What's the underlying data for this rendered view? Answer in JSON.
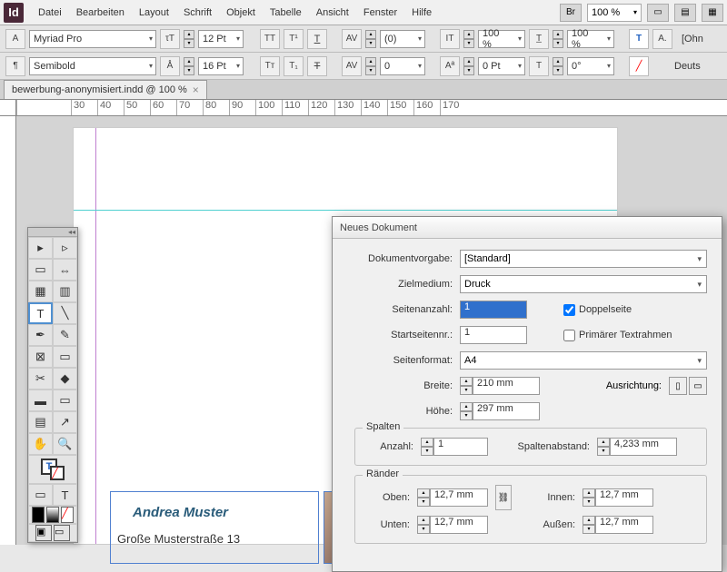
{
  "app": {
    "icon": "Id"
  },
  "menu": {
    "items": [
      "Datei",
      "Bearbeiten",
      "Layout",
      "Schrift",
      "Objekt",
      "Tabelle",
      "Ansicht",
      "Fenster",
      "Hilfe"
    ],
    "br_label": "Br",
    "zoom": "100 %"
  },
  "control": {
    "font": "Myriad Pro",
    "weight": "Semibold",
    "size": "12 Pt",
    "leading": "16 Pt",
    "tracking": "(0)",
    "baseline": "0",
    "vscale": "100 %",
    "hscale": "100 %",
    "xoffset": "0 Pt",
    "rotation": "0°",
    "lang": "Deuts"
  },
  "tab": {
    "name": "bewerbung-anonymisiert.indd @ 100 %"
  },
  "ruler": [
    "30",
    "40",
    "50",
    "60",
    "70",
    "80",
    "90",
    "100",
    "110",
    "120",
    "130",
    "140",
    "150",
    "160",
    "170"
  ],
  "document": {
    "name": "Andrea Muster",
    "address": "Große Musterstraße 13"
  },
  "dialog": {
    "title": "Neues Dokument",
    "preset_label": "Dokumentvorgabe:",
    "preset_value": "[Standard]",
    "intent_label": "Zielmedium:",
    "intent_value": "Druck",
    "pages_label": "Seitenanzahl:",
    "pages_value": "1",
    "facing_label": "Doppelseite",
    "startpage_label": "Startseitennr.:",
    "startpage_value": "1",
    "primaryframe_label": "Primärer Textrahmen",
    "pagesize_label": "Seitenformat:",
    "pagesize_value": "A4",
    "width_label": "Breite:",
    "width_value": "210 mm",
    "height_label": "Höhe:",
    "height_value": "297 mm",
    "orientation_label": "Ausrichtung:",
    "columns_legend": "Spalten",
    "columns_count_label": "Anzahl:",
    "columns_count_value": "1",
    "gutter_label": "Spaltenabstand:",
    "gutter_value": "4,233 mm",
    "margins_legend": "Ränder",
    "margin_top_label": "Oben:",
    "margin_bottom_label": "Unten:",
    "margin_inside_label": "Innen:",
    "margin_outside_label": "Außen:",
    "margin_value": "12,7 mm"
  }
}
